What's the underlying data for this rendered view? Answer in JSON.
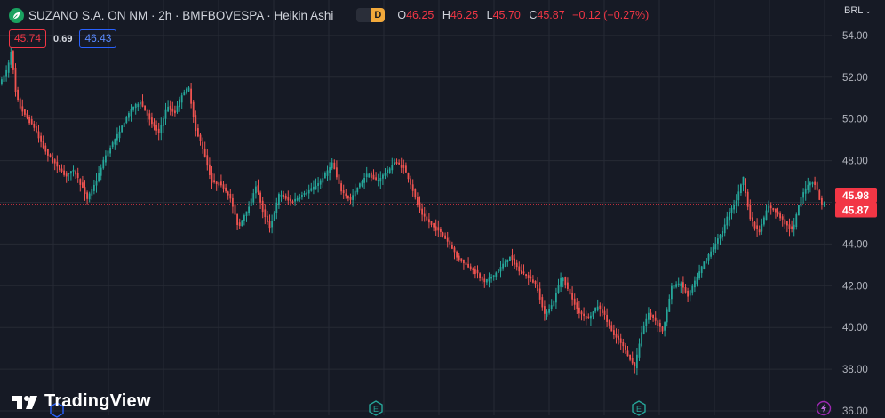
{
  "header": {
    "symbol_title": "SUZANO S.A. ON NM · 2h · BMFBOVESPA · Heikin Ashi",
    "market_badge": "D",
    "ohlc": {
      "open_label": "O",
      "open": "46.25",
      "high_label": "H",
      "high": "46.25",
      "low_label": "L",
      "low": "45.70",
      "close_label": "C",
      "close": "45.87",
      "change": "−0.12 (−0.27%)"
    },
    "bid": "45.74",
    "spread": "0.69",
    "ask": "46.43",
    "currency": "BRL"
  },
  "brand": {
    "name": "TradingView"
  },
  "colors": {
    "background": "#161a25",
    "up": "#26a69a",
    "down": "#ef5350",
    "grid": "#262a35",
    "last_price": "#f23645"
  },
  "chart_data": {
    "type": "candlestick",
    "style": "Heikin Ashi",
    "timeframe": "2h",
    "ylim": [
      36,
      55
    ],
    "y_ticks": [
      "36.00",
      "38.00",
      "40.00",
      "42.00",
      "44.00",
      "46.00",
      "48.00",
      "50.00",
      "52.00",
      "54.00"
    ],
    "price_labels": [
      {
        "value": 45.98,
        "label": "45.98"
      },
      {
        "value": 45.87,
        "label": "45.87"
      }
    ],
    "last_price_line": 45.87,
    "grid": true,
    "anchors": [
      [
        0,
        51.5
      ],
      [
        10,
        52.4
      ],
      [
        15,
        53.4
      ],
      [
        18,
        51.5
      ],
      [
        25,
        50.5
      ],
      [
        40,
        49.6
      ],
      [
        55,
        48.3
      ],
      [
        65,
        47.8
      ],
      [
        75,
        47.3
      ],
      [
        85,
        47.5
      ],
      [
        100,
        46.2
      ],
      [
        110,
        47.0
      ],
      [
        120,
        48.2
      ],
      [
        135,
        49.3
      ],
      [
        150,
        50.5
      ],
      [
        160,
        50.8
      ],
      [
        170,
        50.0
      ],
      [
        180,
        49.3
      ],
      [
        190,
        50.6
      ],
      [
        198,
        50.3
      ],
      [
        206,
        51.1
      ],
      [
        214,
        51.5
      ],
      [
        222,
        49.5
      ],
      [
        232,
        48.3
      ],
      [
        240,
        47.0
      ],
      [
        250,
        46.9
      ],
      [
        262,
        46.1
      ],
      [
        270,
        44.8
      ],
      [
        282,
        45.8
      ],
      [
        290,
        46.8
      ],
      [
        298,
        45.5
      ],
      [
        306,
        44.8
      ],
      [
        316,
        46.4
      ],
      [
        330,
        46.0
      ],
      [
        345,
        46.4
      ],
      [
        358,
        46.8
      ],
      [
        366,
        47.2
      ],
      [
        376,
        47.9
      ],
      [
        386,
        46.5
      ],
      [
        396,
        46.1
      ],
      [
        406,
        46.8
      ],
      [
        416,
        47.4
      ],
      [
        426,
        47.0
      ],
      [
        436,
        47.4
      ],
      [
        446,
        47.9
      ],
      [
        456,
        47.7
      ],
      [
        466,
        46.6
      ],
      [
        476,
        45.4
      ],
      [
        486,
        45.0
      ],
      [
        496,
        44.6
      ],
      [
        506,
        44.1
      ],
      [
        516,
        43.4
      ],
      [
        526,
        43.0
      ],
      [
        536,
        42.7
      ],
      [
        546,
        42.2
      ],
      [
        556,
        42.4
      ],
      [
        566,
        42.9
      ],
      [
        576,
        43.4
      ],
      [
        586,
        42.7
      ],
      [
        596,
        42.4
      ],
      [
        606,
        42.0
      ],
      [
        614,
        40.6
      ],
      [
        624,
        41.1
      ],
      [
        634,
        42.5
      ],
      [
        644,
        41.5
      ],
      [
        654,
        40.7
      ],
      [
        664,
        40.4
      ],
      [
        674,
        41.0
      ],
      [
        682,
        40.6
      ],
      [
        690,
        39.8
      ],
      [
        700,
        39.3
      ],
      [
        708,
        38.7
      ],
      [
        716,
        38.1
      ],
      [
        724,
        39.8
      ],
      [
        732,
        40.7
      ],
      [
        740,
        40.3
      ],
      [
        748,
        39.8
      ],
      [
        758,
        42.0
      ],
      [
        768,
        42.1
      ],
      [
        776,
        41.5
      ],
      [
        784,
        42.2
      ],
      [
        794,
        43.1
      ],
      [
        804,
        43.8
      ],
      [
        814,
        44.5
      ],
      [
        822,
        45.5
      ],
      [
        830,
        46.0
      ],
      [
        838,
        47.2
      ],
      [
        846,
        45.2
      ],
      [
        856,
        44.5
      ],
      [
        866,
        45.8
      ],
      [
        876,
        45.5
      ],
      [
        886,
        45.0
      ],
      [
        894,
        44.6
      ],
      [
        902,
        46.1
      ],
      [
        910,
        46.8
      ],
      [
        918,
        47.0
      ],
      [
        926,
        45.9
      ]
    ]
  }
}
